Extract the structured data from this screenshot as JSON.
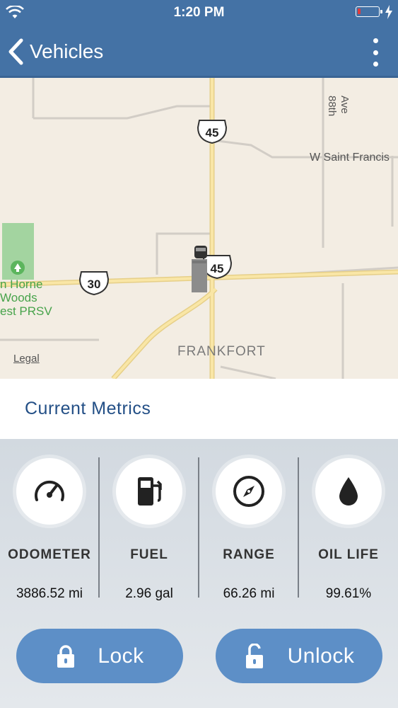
{
  "status_bar": {
    "time": "1:20 PM"
  },
  "nav": {
    "back_label": "Vehicles"
  },
  "map": {
    "legal": "Legal",
    "labels": {
      "route_45_top": "45",
      "route_45_mid": "45",
      "route_30": "30",
      "ave_88th_line1": "88th",
      "ave_88th_line2": "Ave",
      "saint_francis": "W Saint Francis",
      "preserve_line1": "n Horne",
      "preserve_line2": "Woods",
      "preserve_line3": "est PRSV",
      "frankfort": "FRANKFORT"
    }
  },
  "section": {
    "title": "Current Metrics"
  },
  "metrics": [
    {
      "label": "ODOMETER",
      "value": "3886.52 mi",
      "icon": "speedometer-icon"
    },
    {
      "label": "FUEL",
      "value": "2.96 gal",
      "icon": "fuel-pump-icon"
    },
    {
      "label": "RANGE",
      "value": "66.26 mi",
      "icon": "compass-icon"
    },
    {
      "label": "OIL LIFE",
      "value": "99.61%",
      "icon": "oil-drop-icon"
    }
  ],
  "actions": {
    "lock_label": "Lock",
    "unlock_label": "Unlock"
  },
  "colors": {
    "header": "#4472a5",
    "accent_text": "#234f86",
    "button": "#5d8fc7",
    "map_bg": "#f3ede3",
    "road": "#f6d98c",
    "park": "#a3d4a0"
  }
}
